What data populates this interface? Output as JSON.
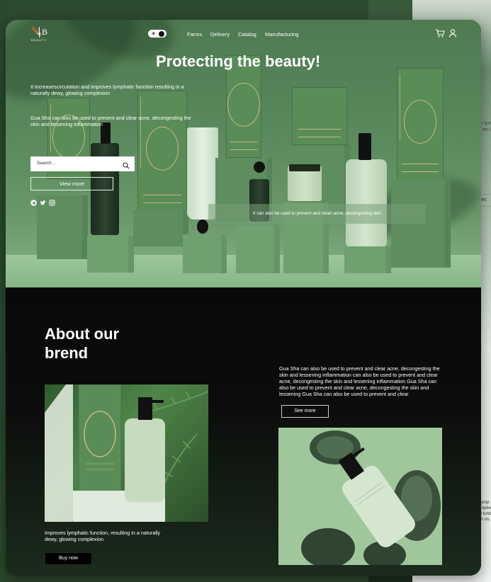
{
  "brand": {
    "mark": "🪶",
    "letter": "B",
    "word": "BEAUTY"
  },
  "nav": {
    "links": [
      "Farms",
      "Delivery",
      "Catalog",
      "Manufacturing"
    ],
    "theme_toggle_icon": "sun-icon",
    "cart_icon": "cart-icon",
    "user_icon": "user-icon"
  },
  "hero": {
    "title": "Protecting the beauty!",
    "paragraph1": "It increasescirculation and improves  lymphatic fanction resulting in a naturally dewy, glowing complexion",
    "paragraph2": "Gua Sha can also be used to prevent and clear acne, decongesting the skin and lessening inflammation",
    "search_placeholder": "Search...",
    "view_more": "View more",
    "socials": [
      "telegram-icon",
      "twitter-icon",
      "instagram-icon"
    ],
    "caption": "It can also be used to prevent and clean acne, decongesting skin"
  },
  "about": {
    "title": "About our brend",
    "text": "Gua Sha can also be used to prevent and clear acne, decongesting the skin and lessening inflammation can also be used to prevent and clear acne, decongesting the skin and lessening inflammation Gua Sha can also be used to prevent and clear acne, decongesting the skin and lessening Gua Sha can also be used to prevent and clear",
    "see_more": "See more",
    "caption": "Improves lymphatic function, resulting in a naturally dewy, glowing complexion",
    "buy_now": "Buy now"
  },
  "backdrop": {
    "text1": "oup lym , glo en I",
    "pill": "Sec",
    "me": "ME",
    "text2": "s i lymp , glo nplexi en I tunity arch un,"
  },
  "colors": {
    "hero_green": "#5a8a5d",
    "floor_green": "#9cc79b",
    "dark_bg": "#0c0d0c",
    "text_white": "#ffffff"
  }
}
